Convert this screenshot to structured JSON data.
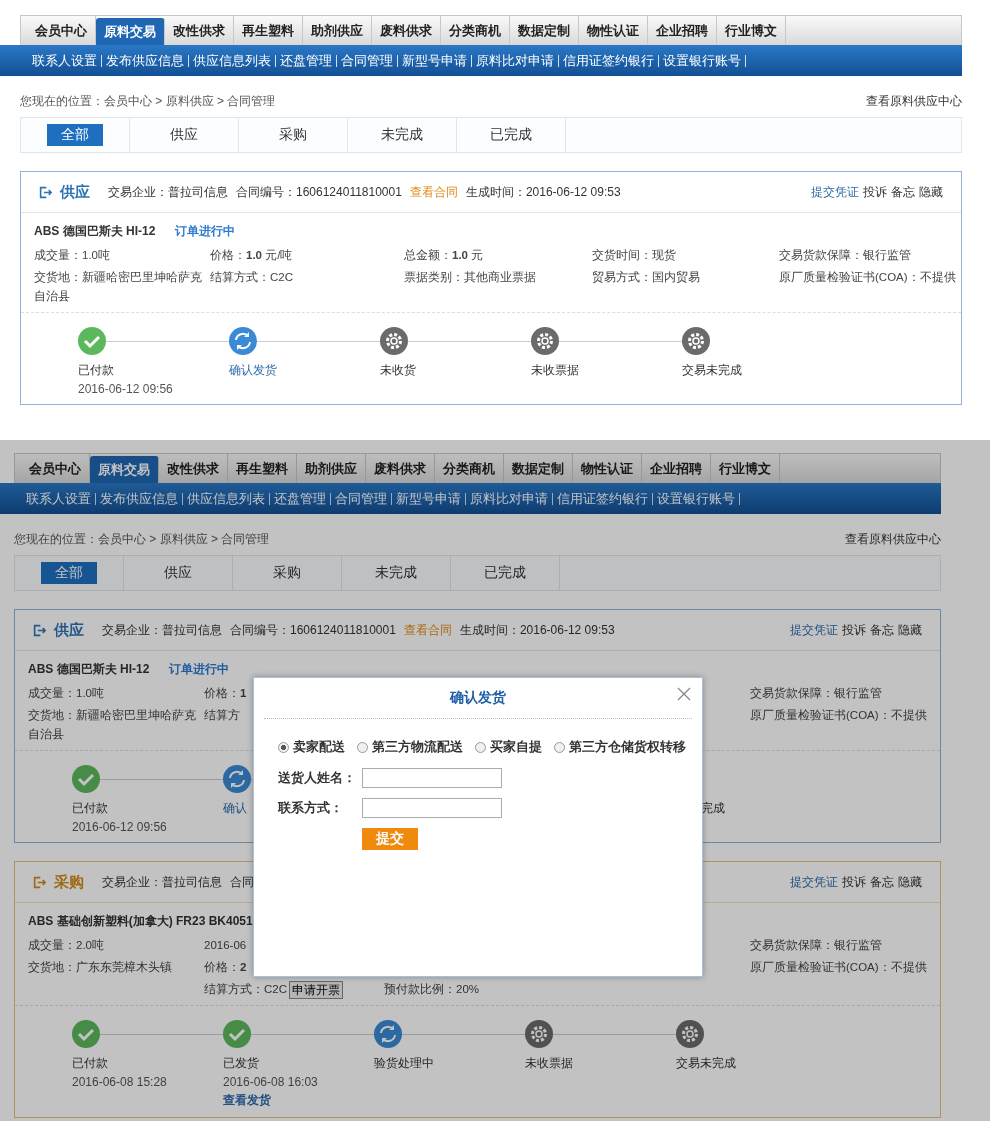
{
  "screens": [
    {
      "nav_tabs": [
        {
          "label": "会员中心",
          "selected": false
        },
        {
          "label": "原料交易",
          "selected": true
        },
        {
          "label": "改性供求",
          "selected": false
        },
        {
          "label": "再生塑料",
          "selected": false
        },
        {
          "label": "助剂供应",
          "selected": false
        },
        {
          "label": "废料供求",
          "selected": false
        },
        {
          "label": "分类商机",
          "selected": false
        },
        {
          "label": "数据定制",
          "selected": false
        },
        {
          "label": "物性认证",
          "selected": false
        },
        {
          "label": "企业招聘",
          "selected": false
        },
        {
          "label": "行业博文",
          "selected": false
        }
      ],
      "subnav_links": [
        "联系人设置",
        "发布供应信息",
        "供应信息列表",
        "还盘管理",
        "合同管理",
        "新型号申请",
        "原料比对申请",
        "信用证签约银行",
        "设置银行账号"
      ],
      "breadcrumb": "您现在的位置：会员中心 > 原料供应 > 合同管理",
      "center_link": "查看原料供应中心",
      "filter_tabs": [
        {
          "label": "全部",
          "selected": true
        },
        {
          "label": "供应",
          "selected": false
        },
        {
          "label": "采购",
          "selected": false
        },
        {
          "label": "未完成",
          "selected": false
        },
        {
          "label": "已完成",
          "selected": false
        }
      ],
      "cards": [
        {
          "kind": "supply",
          "title": "供应",
          "header_fields": [
            {
              "kind": "text",
              "text": "交易企业：普拉司信息"
            },
            {
              "kind": "text",
              "text": "合同编号：1606124011810001"
            },
            {
              "kind": "link",
              "text": "查看合同"
            },
            {
              "kind": "text",
              "text": "生成时间：2016-06-12 09:53"
            }
          ],
          "actions": [
            {
              "kind": "primary",
              "text": "提交凭证"
            },
            {
              "kind": "plain",
              "text": "投诉"
            },
            {
              "kind": "plain",
              "text": "备忘"
            },
            {
              "kind": "plain",
              "text": "隐藏"
            }
          ],
          "product": "ABS 德国巴斯夫 HI-12",
          "status": "订单进行中",
          "rows": [
            [
              {
                "text": "成交量：1.0吨"
              },
              {
                "text": "价格：**1.0** 元/吨"
              },
              {
                "text": "总金额：**1.0** 元",
                "kind": "large"
              },
              {
                "text": "交货时间：现货"
              },
              {
                "text": "交易货款保障：银行监管"
              }
            ],
            [
              {
                "text": "交货地：新疆哈密巴里坤哈萨克自治县"
              },
              {
                "text": "结算方式：C2C"
              },
              {
                "text": "票据类别：其他商业票据"
              },
              {
                "text": "贸易方式：国内贸易"
              },
              {
                "text": "原厂质量检验证书(COA)：不提供"
              }
            ]
          ],
          "steps": [
            {
              "label": "已付款",
              "kind": "done",
              "time": "2016-06-12 09:56"
            },
            {
              "label": "确认发货",
              "kind": "current",
              "action": true
            },
            {
              "label": "未收货",
              "kind": "pending"
            },
            {
              "label": "未收票据",
              "kind": "pending"
            },
            {
              "label": "交易未完成",
              "kind": "pending"
            }
          ]
        }
      ]
    },
    {
      "nav_tabs": [
        {
          "label": "会员中心",
          "selected": false
        },
        {
          "label": "原料交易",
          "selected": true
        },
        {
          "label": "改性供求",
          "selected": false
        },
        {
          "label": "再生塑料",
          "selected": false
        },
        {
          "label": "助剂供应",
          "selected": false
        },
        {
          "label": "废料供求",
          "selected": false
        },
        {
          "label": "分类商机",
          "selected": false
        },
        {
          "label": "数据定制",
          "selected": false
        },
        {
          "label": "物性认证",
          "selected": false
        },
        {
          "label": "企业招聘",
          "selected": false
        },
        {
          "label": "行业博文",
          "selected": false
        }
      ],
      "subnav_links": [
        "联系人设置",
        "发布供应信息",
        "供应信息列表",
        "还盘管理",
        "合同管理",
        "新型号申请",
        "原料比对申请",
        "信用证签约银行",
        "设置银行账号"
      ],
      "breadcrumb": "您现在的位置：会员中心 > 原料供应 > 合同管理",
      "center_link": "查看原料供应中心",
      "filter_tabs": [
        {
          "label": "全部",
          "selected": true
        },
        {
          "label": "供应",
          "selected": false
        },
        {
          "label": "采购",
          "selected": false
        },
        {
          "label": "未完成",
          "selected": false
        },
        {
          "label": "已完成",
          "selected": false
        }
      ],
      "cards": [
        {
          "kind": "supply",
          "title": "供应",
          "header_fields": [
            {
              "kind": "text",
              "text": "交易企业：普拉司信息"
            },
            {
              "kind": "text",
              "text": "合同编号：1606124011810001"
            },
            {
              "kind": "link",
              "text": "查看合同"
            },
            {
              "kind": "text",
              "text": "生成时间：2016-06-12 09:53"
            }
          ],
          "actions": [
            {
              "kind": "primary",
              "text": "提交凭证"
            },
            {
              "kind": "plain",
              "text": "投诉"
            },
            {
              "kind": "plain",
              "text": "备忘"
            },
            {
              "kind": "plain",
              "text": "隐藏"
            }
          ],
          "product": "ABS 德国巴斯夫 HI-12",
          "status": "订单进行中",
          "rows": [
            [
              {
                "text": "成交量：1.0吨"
              },
              {
                "text": "价格：**1**"
              },
              {
                "kind": "covered"
              },
              {
                "kind": "covered"
              },
              {
                "text": "交易货款保障：银行监管"
              }
            ],
            [
              {
                "text": "交货地：新疆哈密巴里坤哈萨克自治县"
              },
              {
                "text": "结算方"
              },
              {
                "kind": "covered"
              },
              {
                "kind": "covered"
              },
              {
                "text": "原厂质量检验证书(COA)：不提供"
              }
            ]
          ],
          "steps": [
            {
              "label": "已付款",
              "kind": "done",
              "time": "2016-06-12 09:56"
            },
            {
              "label": "确认",
              "kind": "current",
              "action": true
            },
            {
              "kind": "covered"
            },
            {
              "kind": "covered"
            },
            {
              "label": "完成",
              "kind": "covered"
            }
          ]
        },
        {
          "kind": "purchase",
          "title": "采购",
          "header_fields": [
            {
              "kind": "text",
              "text": "交易企业：普拉司信息"
            },
            {
              "kind": "text",
              "text": "合同"
            }
          ],
          "actions": [
            {
              "kind": "primary",
              "text": "提交凭证"
            },
            {
              "kind": "plain",
              "text": "投诉"
            },
            {
              "kind": "plain",
              "text": "备忘"
            },
            {
              "kind": "plain",
              "text": "隐藏"
            }
          ],
          "product": "ABS 基础创新塑料(加拿大) FR23 BK4051",
          "rows": [
            [
              {
                "text": "成交量：2.0吨"
              },
              {
                "text": "2016-06"
              },
              {
                "kind": "covered"
              },
              {
                "kind": "covered"
              },
              {
                "text": "交易货款保障：银行监管"
              }
            ],
            [
              {
                "text": "交货地：广东东莞樟木头镇"
              },
              {
                "text": "价格：**2**"
              },
              {
                "kind": "covered"
              },
              {
                "kind": "covered"
              },
              {
                "text": "原厂质量检验证书(COA)：不提供"
              }
            ],
            [
              {
                "kind": "covered"
              },
              {
                "text": "结算方式：C2C",
                "button": "申请开票"
              },
              {
                "text": "预付款比例：20%"
              },
              {
                "kind": "covered"
              },
              {
                "kind": "covered"
              }
            ]
          ],
          "steps": [
            {
              "label": "已付款",
              "kind": "done",
              "time": "2016-06-08 15:28"
            },
            {
              "label": "已发货",
              "kind": "done",
              "time": "2016-06-08 16:03",
              "link": "查看发货"
            },
            {
              "label": "验货处理中",
              "kind": "current"
            },
            {
              "label": "未收票据",
              "kind": "pending"
            },
            {
              "label": "交易未完成",
              "kind": "pending"
            }
          ]
        }
      ],
      "dialog": {
        "title": "确认发货",
        "options": [
          {
            "label": "卖家配送",
            "selected": true
          },
          {
            "label": "第三方物流配送",
            "selected": false
          },
          {
            "label": "买家自提",
            "selected": false
          },
          {
            "label": "第三方仓储货权转移",
            "selected": false
          }
        ],
        "fields": [
          {
            "label": "送货人姓名："
          },
          {
            "label": "联系方式："
          }
        ],
        "submit": "提交"
      }
    }
  ]
}
